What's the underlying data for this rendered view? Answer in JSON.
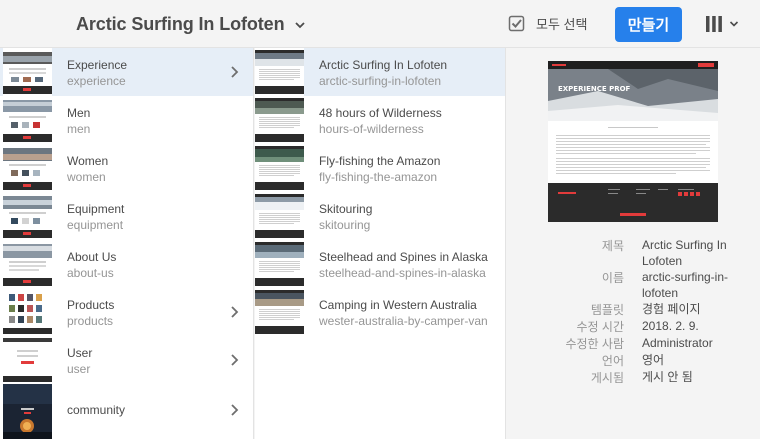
{
  "header": {
    "title": "Arctic Surfing In Lofoten",
    "select_all_label": "모두 선택",
    "create_label": "만들기"
  },
  "column1": {
    "items": [
      {
        "title": "Experience",
        "name": "experience",
        "has_children": true,
        "selected": true
      },
      {
        "title": "Men",
        "name": "men",
        "has_children": false
      },
      {
        "title": "Women",
        "name": "women",
        "has_children": false
      },
      {
        "title": "Equipment",
        "name": "equipment",
        "has_children": false
      },
      {
        "title": "About Us",
        "name": "about-us",
        "has_children": false
      },
      {
        "title": "Products",
        "name": "products",
        "has_children": true
      },
      {
        "title": "User",
        "name": "user",
        "has_children": true
      },
      {
        "title": "community",
        "name": "",
        "has_children": true
      }
    ]
  },
  "column2": {
    "items": [
      {
        "title": "Arctic Surfing In Lofoten",
        "name": "arctic-surfing-in-lofoten",
        "selected": true
      },
      {
        "title": "48 hours of Wilderness",
        "name": "hours-of-wilderness"
      },
      {
        "title": "Fly-fishing the Amazon",
        "name": "fly-fishing-the-amazon"
      },
      {
        "title": "Skitouring",
        "name": "skitouring"
      },
      {
        "title": "Steelhead and Spines in Alaska",
        "name": "steelhead-and-spines-in-alaska"
      },
      {
        "title": "Camping in Western Australia",
        "name": "wester-australia-by-camper-van"
      }
    ]
  },
  "details": {
    "preview_banner": "EXPERIENCE PROF",
    "title_label": "제목",
    "title_value": "Arctic Surfing In Lofoten",
    "name_label": "이름",
    "name_value": "arctic-surfing-in-lofoten",
    "template_label": "템플릿",
    "template_value": "경험 페이지",
    "modified_label": "수정 시간",
    "modified_value": "2018. 2. 9.",
    "modifier_label": "수정한 사람",
    "modifier_value": "Administrator",
    "language_label": "언어",
    "language_value": "영어",
    "published_label": "게시됨",
    "published_value": "게시 안 됨"
  },
  "colors": {
    "accent": "#2680eb",
    "selected_row": "#e6eef7",
    "text": "#4b4b4b",
    "subtext": "#959595"
  },
  "icons": {
    "title_dropdown": "chevron-down-icon",
    "select_all": "checkbox-icon",
    "view": "column-view-icon",
    "row_arrow": "chevron-right-icon"
  }
}
